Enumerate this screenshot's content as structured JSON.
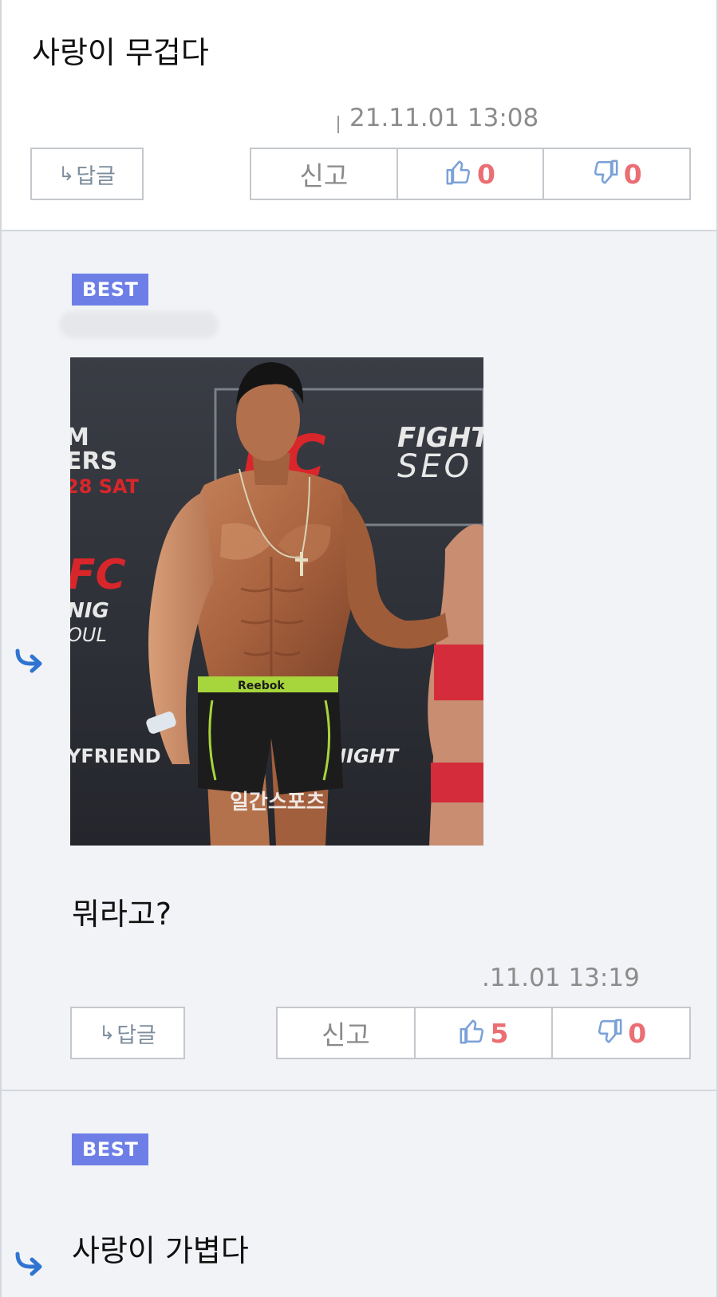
{
  "comments": [
    {
      "text": "사랑이 무겁다",
      "timestamp": "21.11.01 13:08",
      "reply_label": "답글",
      "report_label": "신고",
      "likes": "0",
      "dislikes": "0"
    },
    {
      "badge": "BEST",
      "text": "뭐라고?",
      "timestamp": ".11.01 13:19",
      "reply_label": "답글",
      "report_label": "신고",
      "likes": "5",
      "dislikes": "0",
      "image": {
        "banner_text_1": "FIGHT",
        "banner_text_2": "SEO",
        "banner_logo": "FC",
        "left_text_1": "M",
        "left_text_2": "ERS",
        "left_text_3": "28 SAT",
        "left_text_4": "FC",
        "left_text_5": "NIG",
        "left_text_6": "OUL",
        "left_text_7": "YFRIEND",
        "right_text_1": "NIGHT",
        "waistband_text": "Reebok",
        "watermark": "일간스포츠"
      }
    },
    {
      "badge": "BEST",
      "text": "사랑이 가볍다"
    }
  ],
  "colors": {
    "best_badge": "#6d7fe6",
    "count": "#ea6e73",
    "reply_arrow": "#2f74d0",
    "thumb_icon": "#7ba1d8",
    "panel_bg": "#f2f3f6"
  }
}
